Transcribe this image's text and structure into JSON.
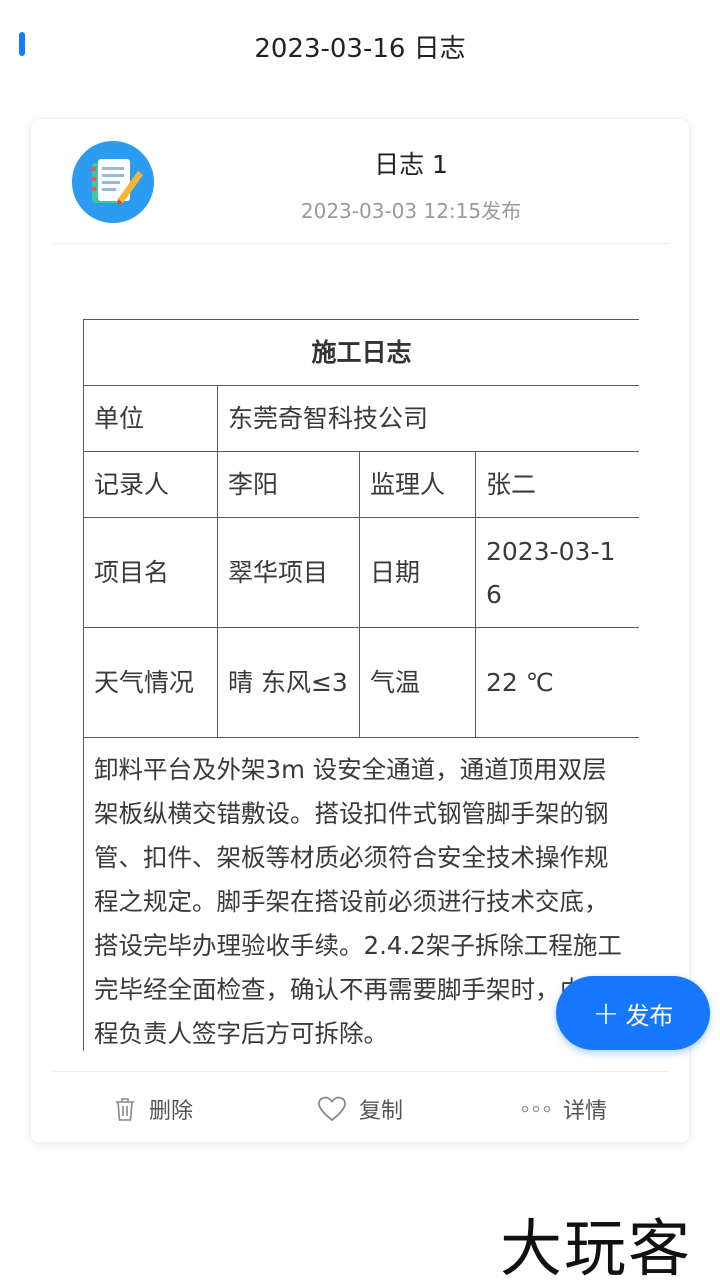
{
  "header": {
    "title": "2023-03-16 日志"
  },
  "log": {
    "title": "日志 1",
    "published": "2023-03-03 12:15发布"
  },
  "table": {
    "heading": "施工日志",
    "unit_label": "单位",
    "unit_value": "东莞奇智科技公司",
    "recorder_label": "记录人",
    "recorder_value": "李阳",
    "supervisor_label": "监理人",
    "supervisor_value": "张二",
    "project_label": "项目名",
    "project_value": "翠华项目",
    "date_label": "日期",
    "date_value": "2023-03-16",
    "weather_label": "天气情况",
    "weather_value": "晴 东风≤3",
    "temp_label": "气温",
    "temp_value": "22 ℃",
    "content": "卸料平台及外架3m 设安全通道，通道顶用双层架板纵横交错敷设。搭设扣件式钢管脚手架的钢管、扣件、架板等材质必须符合安全技术操作规程之规定。脚手架在搭设前必须进行技术交底，搭设完毕办理验收手续。2.4.2架子拆除工程施工完毕经全面检查，确认不再需要脚手架时，由工程负责人签字后方可拆除。"
  },
  "actions": {
    "delete": "删除",
    "copy": "复制",
    "detail": "详情"
  },
  "fab": {
    "label": "发布"
  },
  "watermark": {
    "text": "大玩客"
  },
  "icons": {
    "avatar": "notebook-pencil-icon",
    "delete": "trash-icon",
    "copy": "heart-icon",
    "detail": "more-dots-icon"
  },
  "colors": {
    "accent": "#1677ff",
    "avatar_bg": "#2b9cf2"
  }
}
